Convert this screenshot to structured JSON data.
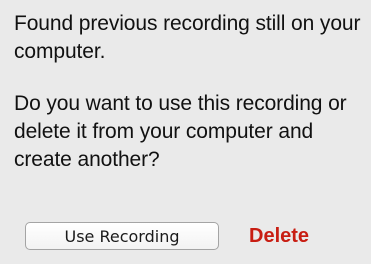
{
  "dialog": {
    "message_1": "Found previous recording still on your computer.",
    "message_2": "Do you want to use this recording or delete it from your computer and create another?",
    "use_button_label": "Use Recording",
    "delete_button_label": "Delete",
    "delete_color": "#c81d12"
  }
}
